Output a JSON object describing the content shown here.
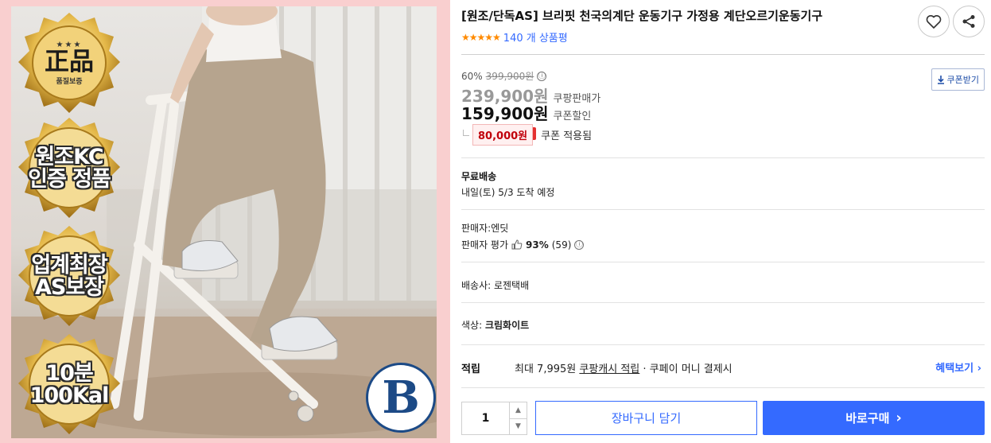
{
  "product": {
    "title": "[원조/단독AS] 브리핏 천국의계단 운동기구 가정용 계단오르기운동기구",
    "rating_stars": "★★★★★",
    "review_count": "140 개 상품평"
  },
  "image": {
    "badges": [
      {
        "top": "★★★",
        "main": "正品",
        "sub": "품질보증"
      },
      {
        "line1": "원조KC",
        "line2": "인증 정품"
      },
      {
        "line1": "업계최장",
        "line2": "AS보장"
      },
      {
        "line1": "10분",
        "line2": "100Kal"
      }
    ],
    "logo": "B"
  },
  "pricing": {
    "discount_rate": "60%",
    "original_price": "399,900원",
    "info_icon": "ⓘ",
    "sale_price": "239,900원",
    "sale_label": "쿠팡판매가",
    "coupon_price": "159,900원",
    "coupon_label": "쿠폰할인",
    "coupon_amount": "80,000원",
    "coupon_applied": "쿠폰 적용됨",
    "coupon_button": "쿠폰받기"
  },
  "shipping": {
    "title": "무료배송",
    "date": "내일(토) 5/3 도착 예정"
  },
  "seller": {
    "name_line": "판매자:엔딧",
    "rating_label": "판매자 평가",
    "rating_pct": "93%",
    "rating_count": "(59)"
  },
  "shipper": {
    "line": "배송사:  로젠택배"
  },
  "option": {
    "label": "색상: ",
    "value": "크림화이트"
  },
  "reward": {
    "label": "적립",
    "prefix": "최대 7,995원",
    "cash_link": "쿠팡캐시 적립",
    "suffix": "· 쿠페이 머니 결제시",
    "benefit_link": "혜택보기 ›"
  },
  "purchase": {
    "quantity": "1",
    "cart_button": "장바구니 담기",
    "buy_button": "바로구매",
    "buy_chevron": "›"
  },
  "colors": {
    "accent": "#346aff",
    "coupon_red": "#c0000b",
    "image_border": "#f9cfcf"
  },
  "icons": [
    "heart-icon",
    "share-icon",
    "download-icon",
    "thumbs-up-icon",
    "info-icon",
    "chevron-right-icon",
    "caret-up-icon",
    "caret-down-icon"
  ]
}
